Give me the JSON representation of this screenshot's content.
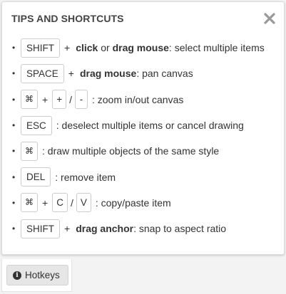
{
  "panel": {
    "title": "TIPS AND SHORTCUTS",
    "close_icon": "close-icon"
  },
  "bullet": "•",
  "shortcuts": [
    {
      "keys": [
        "SHIFT"
      ],
      "pre_sep": "+",
      "parts": [
        {
          "t": "click",
          "b": true
        },
        {
          "t": " or ",
          "b": false
        },
        {
          "t": "drag mouse",
          "b": true
        },
        {
          "t": ": select multiple items",
          "b": false
        }
      ]
    },
    {
      "keys": [
        "SPACE"
      ],
      "pre_sep": "+",
      "parts": [
        {
          "t": "drag mouse",
          "b": true
        },
        {
          "t": ": pan canvas",
          "b": false
        }
      ]
    },
    {
      "keys": [
        "⌘",
        "+",
        "-"
      ],
      "seps": [
        "+",
        "/"
      ],
      "parts": [
        {
          "t": ": zoom in/out canvas",
          "b": false
        }
      ]
    },
    {
      "keys": [
        "ESC"
      ],
      "parts": [
        {
          "t": ": deselect multiple items or cancel drawing",
          "b": false
        }
      ]
    },
    {
      "keys": [
        "⌘"
      ],
      "parts": [
        {
          "t": ": draw multiple objects of the same style",
          "b": false
        }
      ]
    },
    {
      "keys": [
        "DEL"
      ],
      "parts": [
        {
          "t": ": remove item",
          "b": false
        }
      ]
    },
    {
      "keys": [
        "⌘",
        "C",
        "V"
      ],
      "seps": [
        "+",
        "/"
      ],
      "parts": [
        {
          "t": ": copy/paste item",
          "b": false
        }
      ]
    },
    {
      "keys": [
        "SHIFT"
      ],
      "pre_sep": "+",
      "parts": [
        {
          "t": "drag anchor",
          "b": true
        },
        {
          "t": ": snap to aspect ratio",
          "b": false
        }
      ]
    }
  ],
  "hotkeys_button": {
    "label": "Hotkeys",
    "icon": "info-icon"
  }
}
